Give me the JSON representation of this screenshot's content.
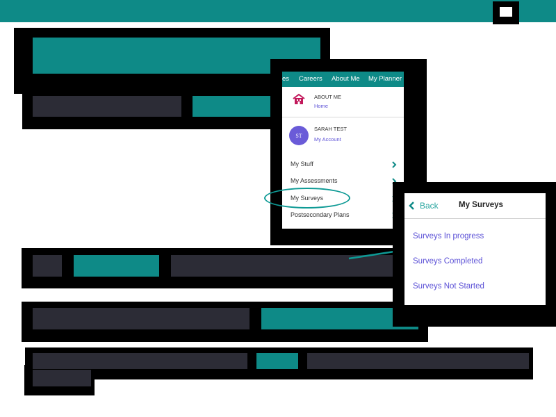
{
  "phone": {
    "nav": [
      "es",
      "Careers",
      "About Me",
      "My Planner"
    ],
    "about_title": "ABOUT ME",
    "about_link": "Home",
    "avatar_initials": "ST",
    "user_name": "SARAH TEST",
    "account_link": "My Account",
    "menu": [
      "My Stuff",
      "My Assessments",
      "My Surveys",
      "Postsecondary Plans"
    ]
  },
  "surveys_panel": {
    "back_label": "Back",
    "title": "My Surveys",
    "links": [
      "Surveys In progress",
      "Surveys Completed",
      "Surveys Not Started"
    ]
  },
  "colors": {
    "accent": "#0e8a87",
    "bar": "#2c2c36",
    "link": "#5b50d6",
    "house": "#c2185b"
  },
  "icons": [
    "house-icon",
    "chevron-right-icon",
    "chevron-left-icon",
    "window-icon",
    "arrow-icon"
  ]
}
